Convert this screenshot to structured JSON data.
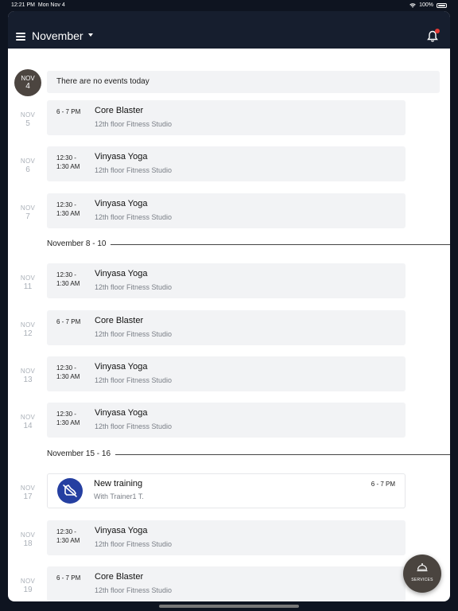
{
  "status_bar": {
    "time": "12:21 PM",
    "date": "Mon Nov 4",
    "battery": "100%"
  },
  "header": {
    "title": "November"
  },
  "today": {
    "month": "NOV",
    "day": "4",
    "message": "There are no events today"
  },
  "days": [
    {
      "month": "NOV",
      "day": "5",
      "time": "6 - 7 PM",
      "title": "Core Blaster",
      "location": "12th floor Fitness Studio"
    },
    {
      "month": "NOV",
      "day": "6",
      "time": "12:30 -\n1:30 AM",
      "title": "Vinyasa Yoga",
      "location": "12th floor Fitness Studio"
    },
    {
      "month": "NOV",
      "day": "7",
      "time": "12:30 -\n1:30 AM",
      "title": "Vinyasa Yoga",
      "location": "12th floor Fitness Studio"
    },
    {
      "month": "NOV",
      "day": "11",
      "time": "12:30 -\n1:30 AM",
      "title": "Vinyasa Yoga",
      "location": "12th floor Fitness Studio"
    },
    {
      "month": "NOV",
      "day": "12",
      "time": "6 - 7 PM",
      "title": "Core Blaster",
      "location": "12th floor Fitness Studio"
    },
    {
      "month": "NOV",
      "day": "13",
      "time": "12:30 -\n1:30 AM",
      "title": "Vinyasa Yoga",
      "location": "12th floor Fitness Studio"
    },
    {
      "month": "NOV",
      "day": "14",
      "time": "12:30 -\n1:30 AM",
      "title": "Vinyasa Yoga",
      "location": "12th floor Fitness Studio"
    },
    {
      "month": "NOV",
      "day": "18",
      "time": "12:30 -\n1:30 AM",
      "title": "Vinyasa Yoga",
      "location": "12th floor Fitness Studio"
    },
    {
      "month": "NOV",
      "day": "19",
      "time": "6 - 7 PM",
      "title": "Core Blaster",
      "location": "12th floor Fitness Studio"
    }
  ],
  "ranges": [
    {
      "label": "November 8 - 10"
    },
    {
      "label": "November 15 - 16"
    }
  ],
  "training": {
    "month": "NOV",
    "day": "17",
    "title": "New training",
    "subtitle": "With Trainer1 T.",
    "time": "6 - 7 PM"
  },
  "fab": {
    "label": "SERVICES"
  },
  "colors": {
    "header_bg": "#161e2e",
    "today_badge": "#4c4540",
    "trainer_avatar": "#253fa1",
    "notification_dot": "#e53935"
  }
}
